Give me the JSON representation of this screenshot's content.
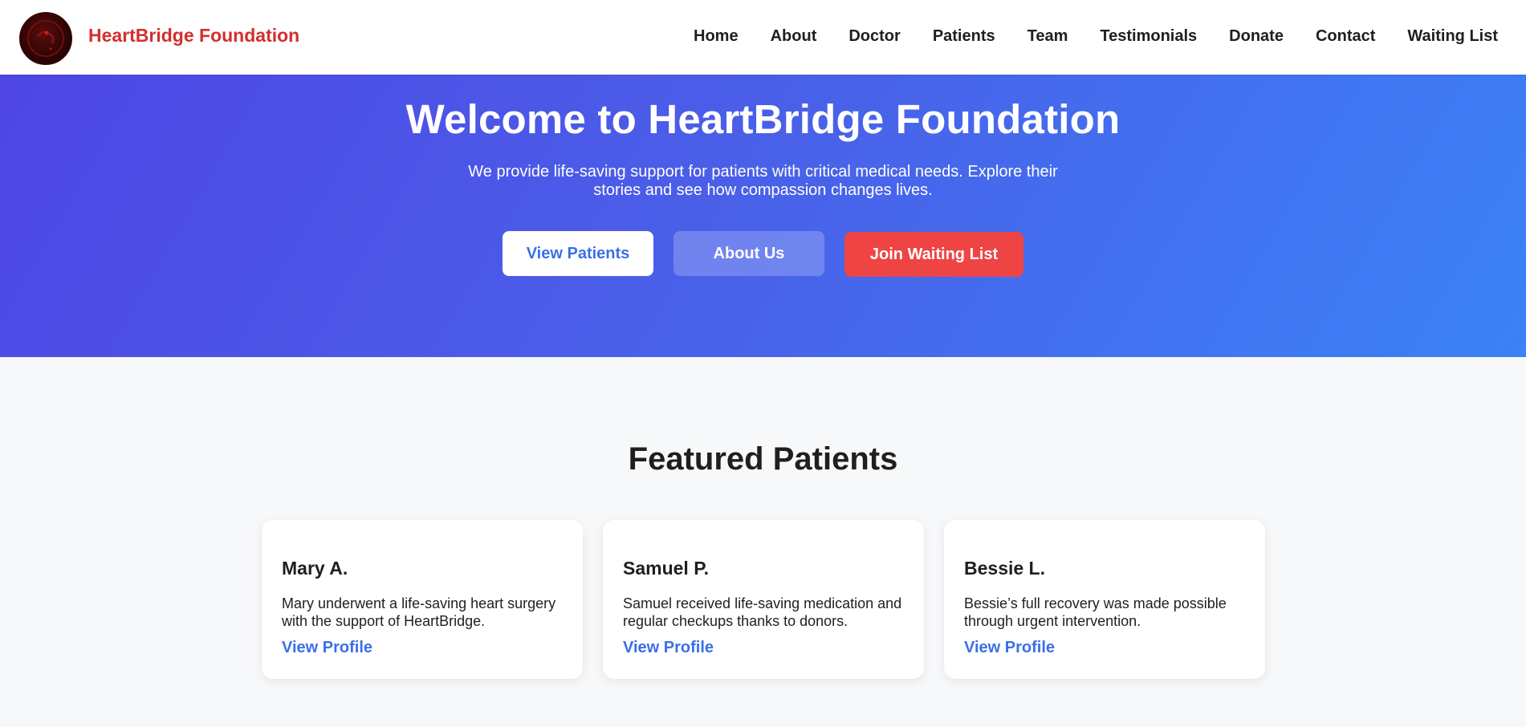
{
  "header": {
    "brand": "HeartBridge Foundation",
    "nav": [
      "Home",
      "About",
      "Doctor",
      "Patients",
      "Team",
      "Testimonials",
      "Donate",
      "Contact",
      "Waiting List"
    ]
  },
  "hero": {
    "title": "Welcome to HeartBridge Foundation",
    "subtitle": "We provide life-saving support for patients with critical medical needs. Explore their stories and see how compassion changes lives.",
    "buttons": {
      "view_patients": "View Patients",
      "about_us": "About Us",
      "join_waiting": "Join Waiting List"
    }
  },
  "featured": {
    "title": "Featured Patients",
    "cards": [
      {
        "name": "Mary A.",
        "desc": "Mary underwent a life-saving heart surgery with the support of HeartBridge.",
        "link": "View Profile"
      },
      {
        "name": "Samuel P.",
        "desc": "Samuel received life-saving medication and regular checkups thanks to donors.",
        "link": "View Profile"
      },
      {
        "name": "Bessie L.",
        "desc": "Bessie’s full recovery was made possible through urgent intervention.",
        "link": "View Profile"
      }
    ]
  },
  "colors": {
    "brand": "#d32f2f",
    "accent": "#3b6fe8",
    "danger": "#ef4444",
    "hero_start": "#4f46e5",
    "hero_end": "#3b82f6"
  }
}
